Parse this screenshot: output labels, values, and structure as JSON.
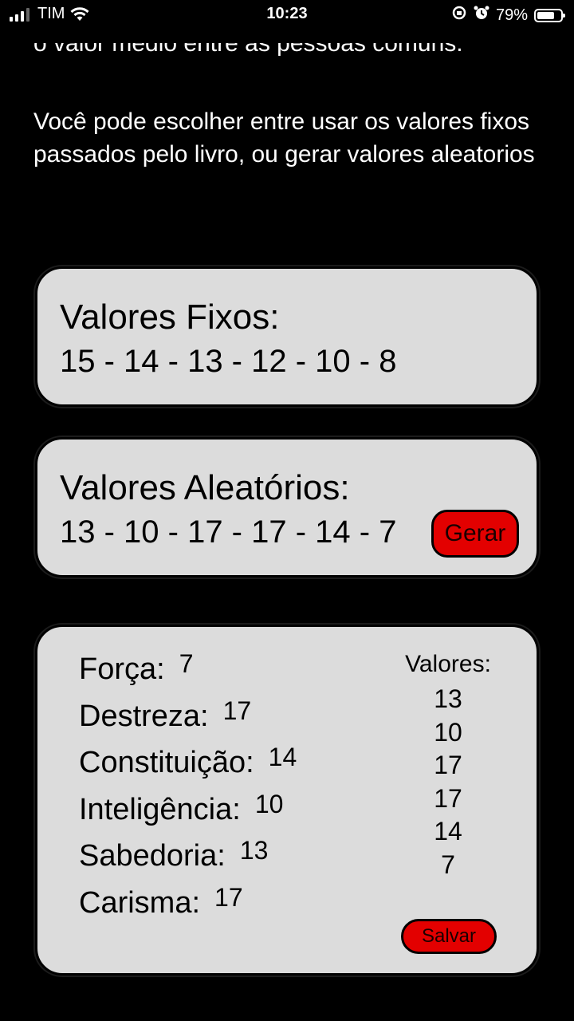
{
  "status_bar": {
    "carrier": "TIM",
    "time": "10:23",
    "battery_percent": "79%",
    "battery_level": 0.79
  },
  "intro": {
    "cut_line": "o valor médio entre as pessoas comuns.",
    "paragraph": "Você pode escolher entre usar os valores fixos passados pelo livro, ou gerar valores aleatorios"
  },
  "fixed_card": {
    "title": "Valores Fixos:",
    "values": "15 - 14 - 13 - 12 - 10 - 8"
  },
  "random_card": {
    "title": "Valores Aleatórios:",
    "values": "13 - 10 - 17 - 17 - 14 - 7",
    "button_label": "Gerar"
  },
  "attributes_card": {
    "attributes": [
      {
        "label": "Força:",
        "value": "7"
      },
      {
        "label": "Destreza:",
        "value": "17"
      },
      {
        "label": "Constituição:",
        "value": "14"
      },
      {
        "label": "Inteligência:",
        "value": "10"
      },
      {
        "label": "Sabedoria:",
        "value": "13"
      },
      {
        "label": "Carisma:",
        "value": "17"
      }
    ],
    "values_title": "Valores:",
    "values": [
      "13",
      "10",
      "17",
      "17",
      "14",
      "7"
    ],
    "button_label": "Salvar"
  },
  "colors": {
    "background": "#000000",
    "card": "#dcdcdc",
    "button": "#e30000"
  }
}
